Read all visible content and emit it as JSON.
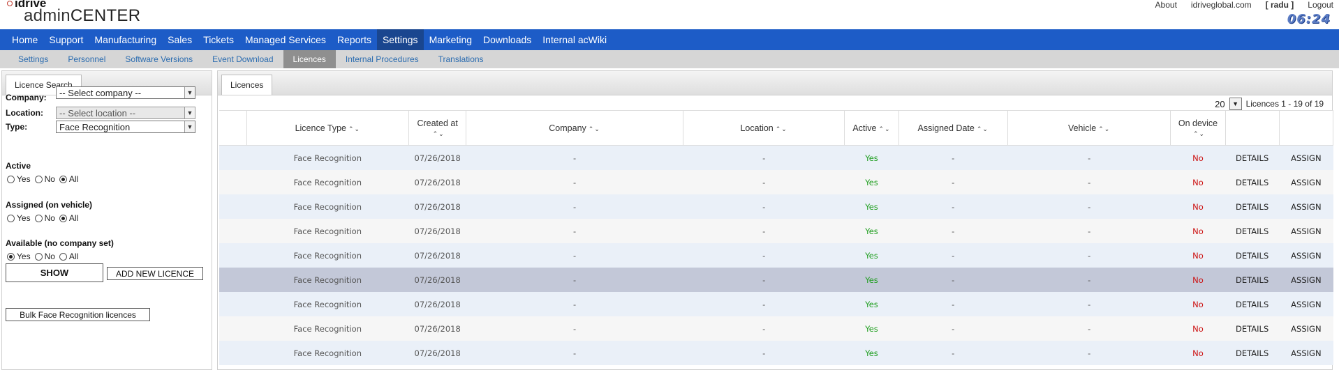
{
  "header": {
    "brand": "idrive",
    "app_title_prefix": "admin",
    "app_title_suffix": "CENTER",
    "links": {
      "about": "About",
      "site": "idriveglobal.com",
      "user": "[ radu ]",
      "logout": "Logout"
    },
    "clock": "06:24"
  },
  "main_nav": [
    "Home",
    "Support",
    "Manufacturing",
    "Sales",
    "Tickets",
    "Managed Services",
    "Reports",
    "Settings",
    "Marketing",
    "Downloads",
    "Internal acWiki"
  ],
  "main_nav_active": "Settings",
  "sub_nav": [
    "Settings",
    "Personnel",
    "Software Versions",
    "Event Download",
    "Licences",
    "Internal Procedures",
    "Translations"
  ],
  "sub_nav_active": "Licences",
  "search": {
    "tab": "Licence Search",
    "company_label": "Company:",
    "company_value": "-- Select company --",
    "location_label": "Location:",
    "location_value": "-- Select location --",
    "type_label": "Type:",
    "type_value": "Face Recognition",
    "active_label": "Active",
    "assigned_label": "Assigned (on vehicle)",
    "available_label": "Available (no company set)",
    "opt_yes": "Yes",
    "opt_no": "No",
    "opt_all": "All",
    "active_selected": "All",
    "assigned_selected": "All",
    "available_selected": "Yes",
    "show_button": "SHOW",
    "add_button": "ADD NEW LICENCE",
    "bulk_button": "Bulk Face Recognition licences"
  },
  "licences": {
    "tab": "Licences",
    "page_size": "20",
    "range_text": "Licences 1 - 19 of 19",
    "columns": [
      "Licence Type",
      "Created at",
      "Company",
      "Location",
      "Active",
      "Assigned Date",
      "Vehicle",
      "On device"
    ],
    "rows": [
      {
        "type": "Face Recognition",
        "created": "07/26/2018",
        "company": "-",
        "location": "-",
        "active": "Yes",
        "assigned": "-",
        "vehicle": "-",
        "on_device": "No",
        "details": "DETAILS",
        "assign": "ASSIGN"
      },
      {
        "type": "Face Recognition",
        "created": "07/26/2018",
        "company": "-",
        "location": "-",
        "active": "Yes",
        "assigned": "-",
        "vehicle": "-",
        "on_device": "No",
        "details": "DETAILS",
        "assign": "ASSIGN"
      },
      {
        "type": "Face Recognition",
        "created": "07/26/2018",
        "company": "-",
        "location": "-",
        "active": "Yes",
        "assigned": "-",
        "vehicle": "-",
        "on_device": "No",
        "details": "DETAILS",
        "assign": "ASSIGN"
      },
      {
        "type": "Face Recognition",
        "created": "07/26/2018",
        "company": "-",
        "location": "-",
        "active": "Yes",
        "assigned": "-",
        "vehicle": "-",
        "on_device": "No",
        "details": "DETAILS",
        "assign": "ASSIGN"
      },
      {
        "type": "Face Recognition",
        "created": "07/26/2018",
        "company": "-",
        "location": "-",
        "active": "Yes",
        "assigned": "-",
        "vehicle": "-",
        "on_device": "No",
        "details": "DETAILS",
        "assign": "ASSIGN"
      },
      {
        "type": "Face Recognition",
        "created": "07/26/2018",
        "company": "-",
        "location": "-",
        "active": "Yes",
        "assigned": "-",
        "vehicle": "-",
        "on_device": "No",
        "details": "DETAILS",
        "assign": "ASSIGN"
      },
      {
        "type": "Face Recognition",
        "created": "07/26/2018",
        "company": "-",
        "location": "-",
        "active": "Yes",
        "assigned": "-",
        "vehicle": "-",
        "on_device": "No",
        "details": "DETAILS",
        "assign": "ASSIGN"
      },
      {
        "type": "Face Recognition",
        "created": "07/26/2018",
        "company": "-",
        "location": "-",
        "active": "Yes",
        "assigned": "-",
        "vehicle": "-",
        "on_device": "No",
        "details": "DETAILS",
        "assign": "ASSIGN"
      },
      {
        "type": "Face Recognition",
        "created": "07/26/2018",
        "company": "-",
        "location": "-",
        "active": "Yes",
        "assigned": "-",
        "vehicle": "-",
        "on_device": "No",
        "details": "DETAILS",
        "assign": "ASSIGN"
      }
    ],
    "selected_row": 5
  },
  "colors": {
    "nav_blue": "#1d5cc7",
    "nav_active": "#1a468f",
    "yes_green": "#1d9d1d",
    "no_red": "#cc1111",
    "row_selected": "#c3c8d8"
  }
}
